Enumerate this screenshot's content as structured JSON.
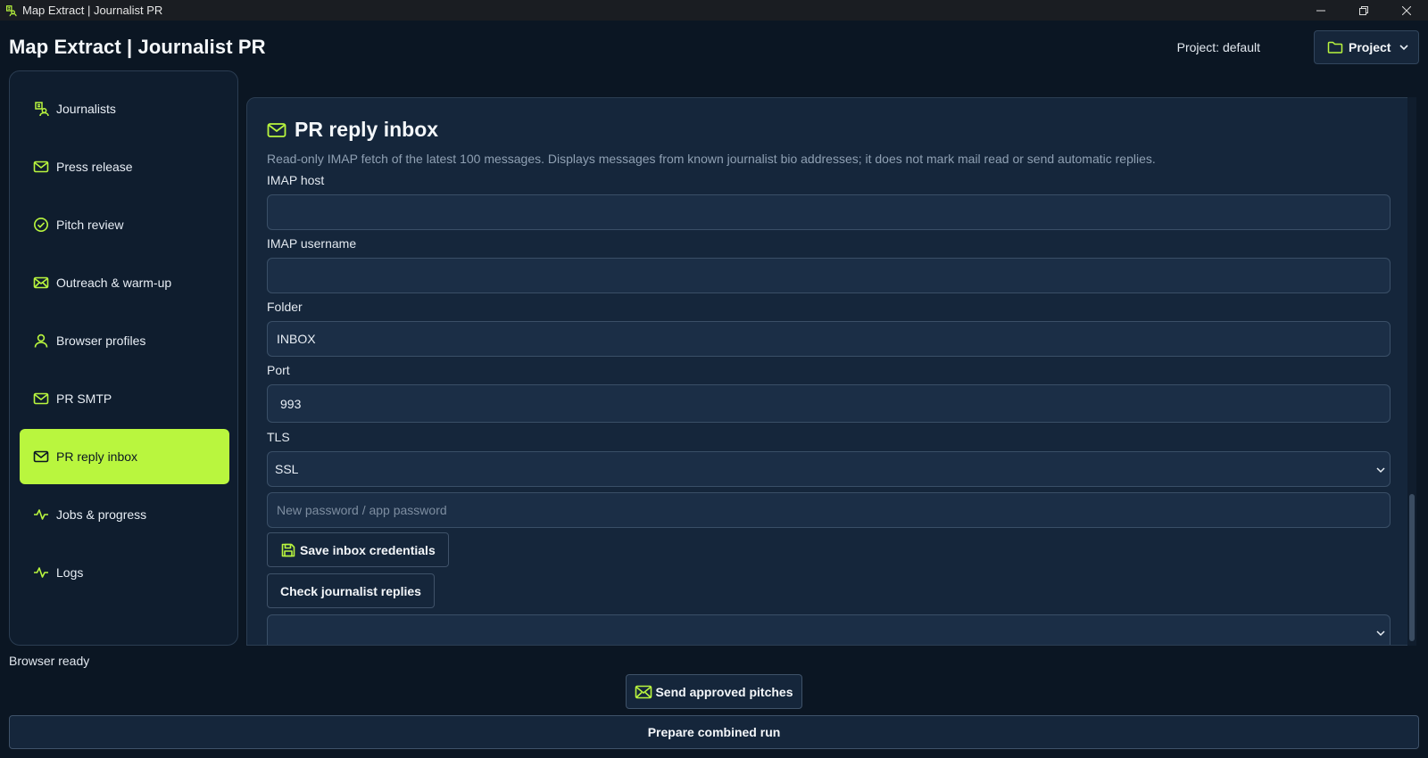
{
  "window": {
    "title": "Map Extract | Journalist PR",
    "icon": "journalist-icon"
  },
  "header": {
    "app_title": "Map Extract | Journalist PR",
    "project_label": "Project: default",
    "project_button": "Project"
  },
  "colors": {
    "accent": "#b9f63e",
    "background": "#0b1623",
    "panel": "#15263b",
    "field": "#1b2e46",
    "border": "#3a4f67"
  },
  "sidebar": {
    "items": [
      {
        "label": "Journalists",
        "icon": "journalist-icon",
        "active": false
      },
      {
        "label": "Press release",
        "icon": "envelope-icon",
        "active": false
      },
      {
        "label": "Pitch review",
        "icon": "check-circle-icon",
        "active": false
      },
      {
        "label": "Outreach & warm-up",
        "icon": "mail-open-icon",
        "active": false
      },
      {
        "label": "Browser profiles",
        "icon": "user-icon",
        "active": false
      },
      {
        "label": "PR SMTP",
        "icon": "envelope-icon",
        "active": false
      },
      {
        "label": "PR reply inbox",
        "icon": "envelope-icon",
        "active": true
      },
      {
        "label": "Jobs & progress",
        "icon": "activity-icon",
        "active": false
      },
      {
        "label": "Logs",
        "icon": "activity-icon",
        "active": false
      }
    ]
  },
  "status": "Browser ready",
  "main": {
    "title": "PR reply inbox",
    "title_icon": "envelope-icon",
    "description": "Read-only IMAP fetch of the latest 100 messages. Displays messages from known journalist bio addresses; it does not mark mail read or send automatic replies.",
    "fields": {
      "imap_host": {
        "label": "IMAP host",
        "value": "",
        "placeholder": ""
      },
      "imap_username": {
        "label": "IMAP username",
        "value": "",
        "placeholder": ""
      },
      "folder": {
        "label": "Folder",
        "value": "INBOX"
      },
      "port": {
        "label": "Port",
        "value": "993"
      },
      "tls": {
        "label": "TLS",
        "value": "SSL"
      },
      "password": {
        "value": "",
        "placeholder": "New password / app password"
      }
    },
    "buttons": {
      "save": "Save inbox credentials",
      "check": "Check journalist replies"
    },
    "reply_select": {
      "value": ""
    }
  },
  "footer": {
    "send_button": "Send approved pitches",
    "combined_button": "Prepare combined run"
  }
}
